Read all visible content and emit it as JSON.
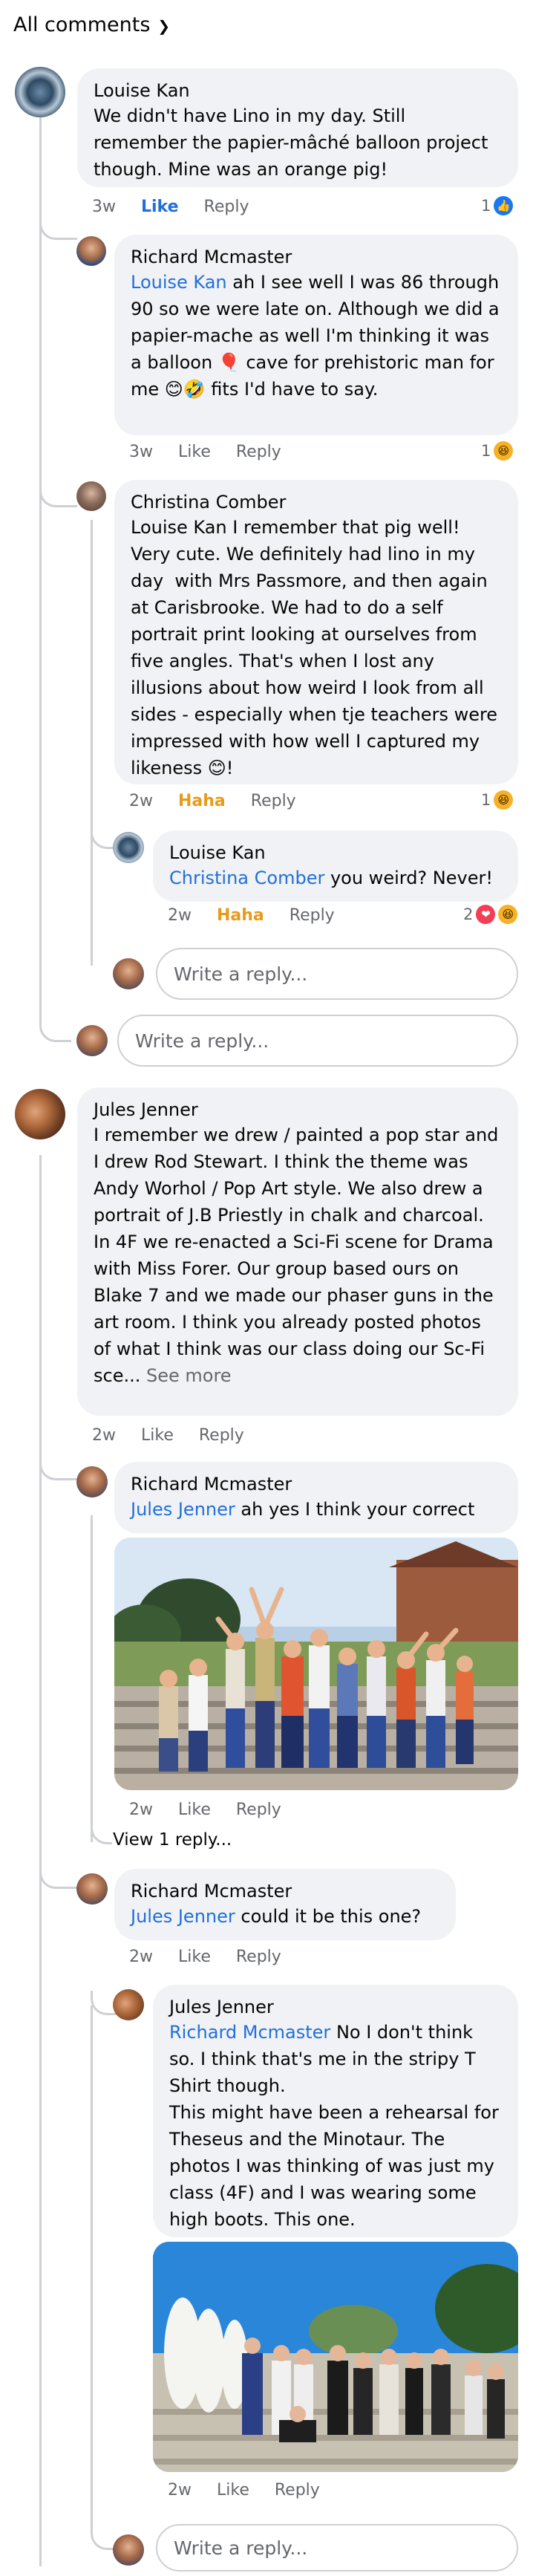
{
  "filter": {
    "label": "All comments"
  },
  "input_placeholder": "Write a reply...",
  "actions": {
    "like": "Like",
    "reply": "Reply",
    "haha": "Haha"
  },
  "c1": {
    "author": "Louise Kan",
    "text": "We didn't have Lino in my day. Still remember the papier-mâché balloon project though. Mine was an orange pig!",
    "time": "3w",
    "reactions": "1"
  },
  "c1r1": {
    "author": "Richard Mcmaster",
    "mention": "Louise Kan",
    "text": " ah I see well I was 86 through 90 so we were late on. Although we did a papier-mache as well I'm thinking it was a balloon 🎈 cave for prehistoric man for me 😊🤣 fits I'd have to say.",
    "time": "3w",
    "reactions": "1"
  },
  "c1r2": {
    "author": "Christina Comber",
    "text": "Louise Kan I remember that pig well! Very cute. We definitely had lino in my day  with Mrs Passmore, and then again at Carisbrooke. We had to do a self portrait print looking at ourselves from five angles. That's when I lost any illusions about how weird I look from all sides - especially when tje teachers were impressed with how well I captured my likeness 😊!",
    "time": "2w",
    "reactions": "1"
  },
  "c1r2r1": {
    "author": "Louise Kan",
    "mention": "Christina Comber",
    "text": " you weird? Never!",
    "time": "2w",
    "reactions": "2"
  },
  "c2": {
    "author": "Jules Jenner",
    "text": "I remember we drew / painted a pop star and I drew Rod Stewart. I think the theme was Andy Worhol / Pop Art style. We also drew a portrait of J.B Priestly in chalk and charcoal.\nIn 4F we re-enacted a Sci-Fi scene for Drama with Miss Forer. Our group based ours on Blake 7 and we made our phaser guns in the art room. I think you already posted photos of what I think was our class doing our Sc-Fi sce...",
    "see_more": "See more",
    "time": "2w"
  },
  "c2r1": {
    "author": "Richard Mcmaster",
    "mention": "Jules Jenner",
    "text": " ah yes I think your correct",
    "time": "2w",
    "view_replies": "View 1 reply..."
  },
  "c2r2": {
    "author": "Richard Mcmaster",
    "mention": "Jules Jenner",
    "text": " could it be this one?",
    "time": "2w"
  },
  "c2r2r1": {
    "author": "Jules Jenner",
    "mention": "Richard Mcmaster",
    "text": " No I don't think so. I think that's me in the stripy T Shirt though.\nThis might have been a rehearsal for Theseus and the Minotaur. The photos I was thinking of was just my class (4F) and I was wearing some high boots. This one.",
    "time": "2w"
  }
}
